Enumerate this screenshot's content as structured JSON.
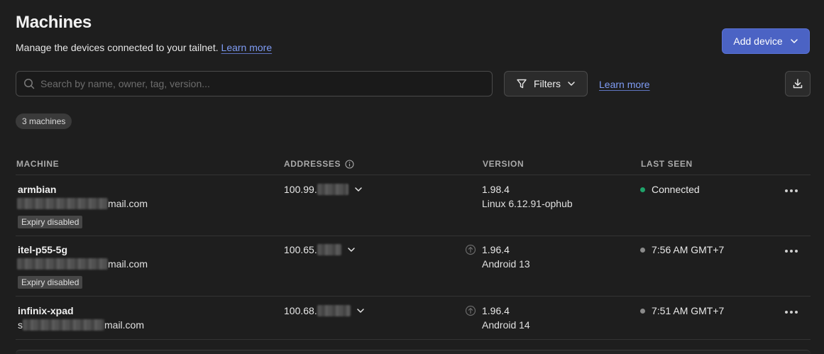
{
  "header": {
    "title": "Machines",
    "subtitle": "Manage the devices connected to your tailnet.",
    "learn_more": "Learn more",
    "add_device": "Add device"
  },
  "toolbar": {
    "search_placeholder": "Search by name, owner, tag, version...",
    "filters_label": "Filters",
    "learn_more": "Learn more"
  },
  "count_label": "3 machines",
  "columns": {
    "machine": "MACHINE",
    "addresses": "ADDRESSES",
    "version": "VERSION",
    "last_seen": "LAST SEEN"
  },
  "machines": [
    {
      "name": "armbian",
      "email_suffix": "mail.com",
      "expiry": "Expiry disabled",
      "address": "100.99.",
      "version": "1.98.4",
      "os": "Linux 6.12.91-ophub",
      "last_seen": "Connected",
      "status": "connected"
    },
    {
      "name": "itel-p55-5g",
      "email_suffix": "mail.com",
      "expiry": "Expiry disabled",
      "address": "100.65.",
      "version": "1.96.4",
      "os": "Android 13",
      "last_seen": "7:56 AM GMT+7",
      "status": "offline"
    },
    {
      "name": "infinix-xpad",
      "email_prefix": "s",
      "email_suffix": "mail.com",
      "address": "100.68.",
      "version": "1.96.4",
      "os": "Android 14",
      "last_seen": "7:51 AM GMT+7",
      "status": "offline"
    }
  ],
  "colors": {
    "background": "#1e1e1e",
    "accent": "#4b63c4",
    "link": "#7f9cf5",
    "connected": "#1fa36a",
    "offline": "#8a8a8a"
  }
}
